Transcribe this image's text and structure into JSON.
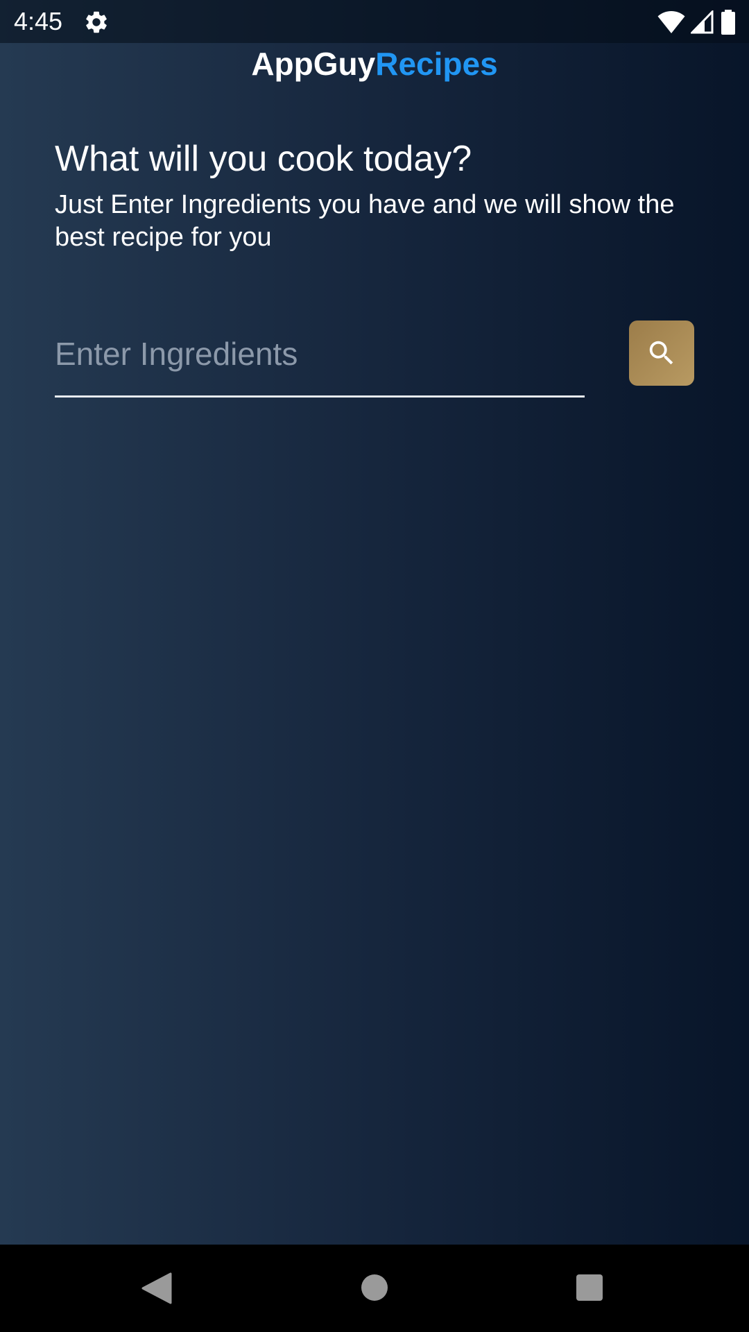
{
  "status_bar": {
    "time": "4:45",
    "icons": [
      "settings-gear-icon",
      "wifi-icon",
      "cellular-signal-icon",
      "battery-icon"
    ]
  },
  "app_title": {
    "part1": "AppGuy",
    "part2": "Recipes",
    "part1_color": "#ffffff",
    "part2_color": "#2196f3"
  },
  "headline": "What will you cook today?",
  "subtext": "Just Enter Ingredients you have and we will show the best recipe for you",
  "search": {
    "placeholder": "Enter Ingredients",
    "value": "",
    "button_icon": "search-icon",
    "button_color": "#b0925a"
  },
  "nav_bar": {
    "icons": [
      "back-icon",
      "home-icon",
      "recents-icon"
    ]
  },
  "colors": {
    "background_start": "#253a52",
    "background_end": "#081529"
  }
}
